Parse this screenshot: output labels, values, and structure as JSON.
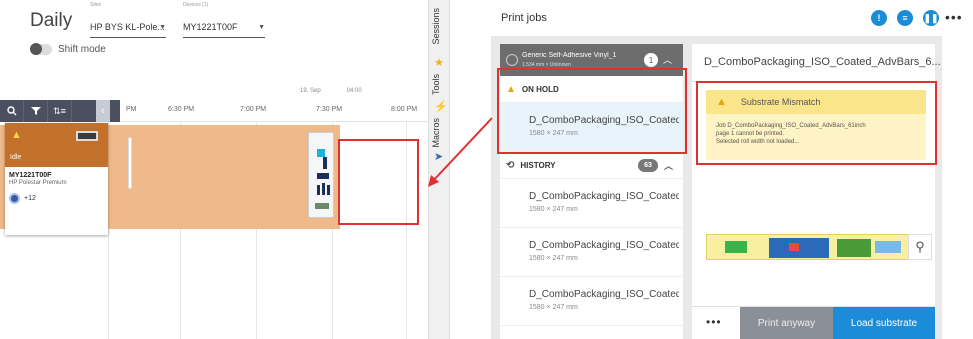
{
  "left": {
    "view_label": "Daily",
    "site_label": "Sites",
    "site_value": "HP BYS KL-Pole...",
    "devices_label": "Devices (1)",
    "device_value": "MY1221T00F",
    "shift_mode": "Shift mode",
    "date_marks": [
      "19. Sep",
      "04:00"
    ],
    "times": [
      "PM",
      "6:30 PM",
      "7:00 PM",
      "7:30 PM",
      "8:00 PM"
    ],
    "device": {
      "status": "Idle",
      "name": "MY1221T00F",
      "media": "HP Polestar Premium",
      "extra": "+12"
    }
  },
  "side_tabs": [
    "Sessions",
    "Tools",
    "Macros"
  ],
  "right": {
    "title": "Print jobs",
    "queue": {
      "name": "Generic Self-Adhesive Vinyl_1",
      "sub": "1.534 mm × Unknown",
      "count": "1"
    },
    "on_hold_label": "ON HOLD",
    "history_label": "HISTORY",
    "history_count": "63",
    "jobs": [
      {
        "name": "D_ComboPackaging_ISO_Coated...",
        "size": "1580 × 247 mm"
      },
      {
        "name": "D_ComboPackaging_ISO_Coated...",
        "size": "1580 × 247 mm"
      },
      {
        "name": "D_ComboPackaging_ISO_Coated...",
        "size": "1580 × 247 mm"
      },
      {
        "name": "D_ComboPackaging_ISO_Coated...",
        "size": "1580 × 247 mm"
      }
    ],
    "detail": {
      "title": "D_ComboPackaging_ISO_Coated_AdvBars_6...",
      "warning_title": "Substrate Mismatch",
      "warning_lines": [
        "Job D_ComboPackaging_ISO_Coated_AdvBars_61inch",
        "page 1 cannot be printed.",
        "Selected roll width not loaded..."
      ],
      "print_anyway": "Print anyway",
      "load_substrate": "Load substrate",
      "more": "•••"
    },
    "header_more": "•••"
  },
  "colors": {
    "accent": "#1a8cd8",
    "alert_red": "#e03030",
    "device_orange": "#c2702a",
    "gantt_orange": "#efb98a",
    "warning_yellow": "#fbe58a"
  }
}
